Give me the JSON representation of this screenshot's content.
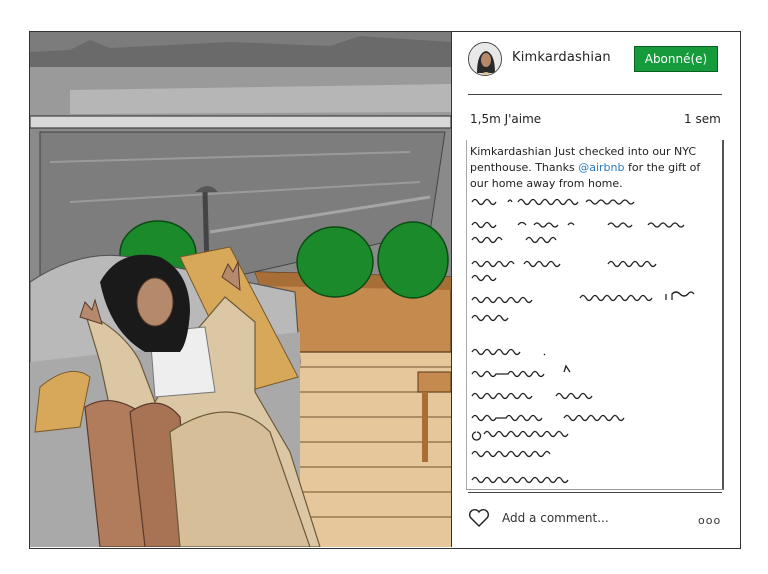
{
  "post": {
    "username": "Kimkardashian",
    "follow_label": "Abonné(e)",
    "likes": "1,5m J'aime",
    "time": "1 sem",
    "caption_user": "Kimkardashian",
    "caption_part1": " Just checked into our NYC penthouse. Thanks ",
    "caption_handle": "@airbnb",
    "caption_part2": " for the gift of our home away from home.",
    "comment_placeholder": "Add a comment...",
    "more_label": "ooo"
  },
  "icons": {
    "like": "heart-icon",
    "more": "more-options-icon"
  },
  "colors": {
    "follow_button": "#159b3b",
    "handle_link": "#2b7bc0"
  }
}
